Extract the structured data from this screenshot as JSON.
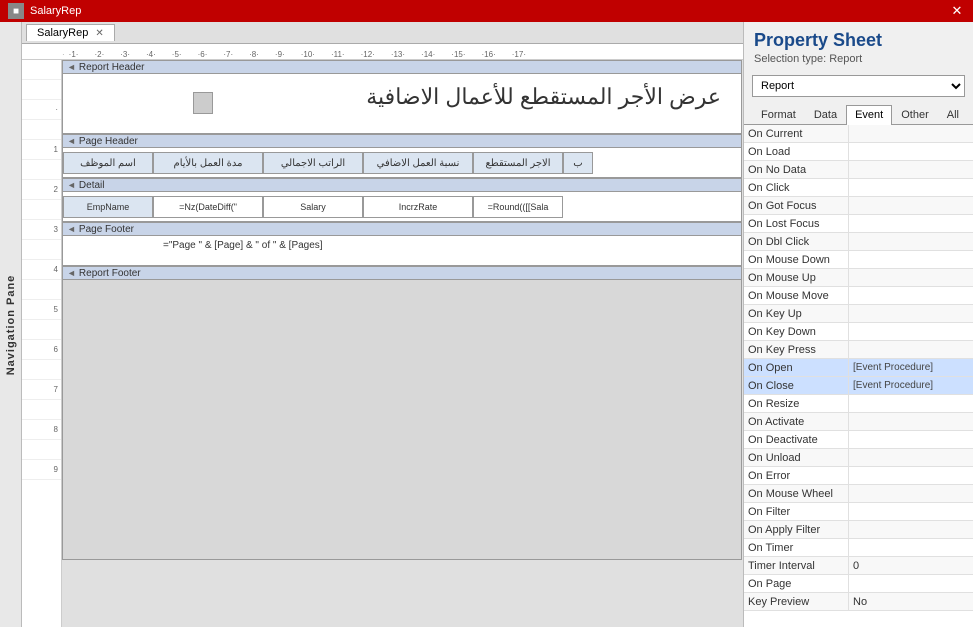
{
  "titleBar": {
    "title": "SalaryRep",
    "closeLabel": "✕"
  },
  "designerTab": {
    "label": "SalaryRep",
    "closeLabel": "✕"
  },
  "navPane": {
    "label": "Navigation Pane"
  },
  "reportSections": {
    "reportHeader": "Report Header",
    "pageHeader": "Page Header",
    "detail": "Detail",
    "pageFooter": "Page Footer",
    "reportFooter": "Report Footer"
  },
  "reportTitle": "عرض الأجر المستقطع للأعمال الاضافية",
  "pageHeaderCells": [
    "اسم الموظف",
    "مدة العمل بالأيام",
    "الراتب الاجمالي",
    "نسبة العمل الاضافي",
    "الاجر المستقطع",
    "ب"
  ],
  "detailCells": [
    "EmpName",
    "=Nz(DateDiff(\"",
    "Salary",
    "IncrzRate",
    "=Round(([[Sala"
  ],
  "pageFooterText": "=\"Page \" & [Page] & \" of \" & [Pages]",
  "propertySheet": {
    "title": "Property Sheet",
    "selectionTypeLabel": "Selection type:",
    "selectionType": "Report",
    "dropdownValue": "Report",
    "tabs": [
      "Format",
      "Data",
      "Event",
      "Other",
      "All"
    ],
    "activeTab": "Event",
    "properties": [
      {
        "label": "On Current",
        "value": ""
      },
      {
        "label": "On Load",
        "value": ""
      },
      {
        "label": "On No Data",
        "value": ""
      },
      {
        "label": "On Click",
        "value": ""
      },
      {
        "label": "On Got Focus",
        "value": ""
      },
      {
        "label": "On Lost Focus",
        "value": ""
      },
      {
        "label": "On Dbl Click",
        "value": ""
      },
      {
        "label": "On Mouse Down",
        "value": ""
      },
      {
        "label": "On Mouse Up",
        "value": ""
      },
      {
        "label": "On Mouse Move",
        "value": ""
      },
      {
        "label": "On Key Up",
        "value": ""
      },
      {
        "label": "On Key Down",
        "value": ""
      },
      {
        "label": "On Key Press",
        "value": ""
      },
      {
        "label": "On Open",
        "value": "[Event Procedure]"
      },
      {
        "label": "On Close",
        "value": "[Event Procedure]"
      },
      {
        "label": "On Resize",
        "value": ""
      },
      {
        "label": "On Activate",
        "value": ""
      },
      {
        "label": "On Deactivate",
        "value": ""
      },
      {
        "label": "On Unload",
        "value": ""
      },
      {
        "label": "On Error",
        "value": ""
      },
      {
        "label": "On Mouse Wheel",
        "value": ""
      },
      {
        "label": "On Filter",
        "value": ""
      },
      {
        "label": "On Apply Filter",
        "value": ""
      },
      {
        "label": "On Timer",
        "value": ""
      },
      {
        "label": "Timer Interval",
        "value": "0"
      },
      {
        "label": "On Page",
        "value": ""
      },
      {
        "label": "Key Preview",
        "value": "No"
      }
    ]
  }
}
